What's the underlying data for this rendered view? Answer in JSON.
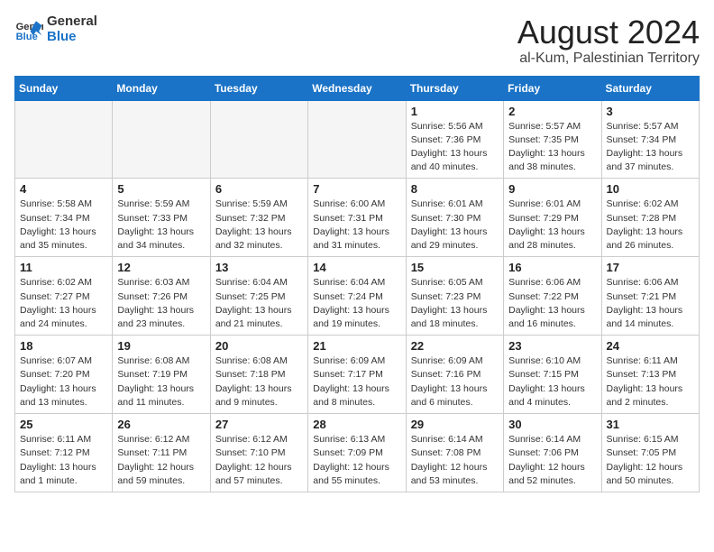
{
  "logo": {
    "text_general": "General",
    "text_blue": "Blue"
  },
  "title": "August 2024",
  "subtitle": "al-Kum, Palestinian Territory",
  "days_of_week": [
    "Sunday",
    "Monday",
    "Tuesday",
    "Wednesday",
    "Thursday",
    "Friday",
    "Saturday"
  ],
  "weeks": [
    [
      {
        "day": "",
        "info": ""
      },
      {
        "day": "",
        "info": ""
      },
      {
        "day": "",
        "info": ""
      },
      {
        "day": "",
        "info": ""
      },
      {
        "day": "1",
        "info": "Sunrise: 5:56 AM\nSunset: 7:36 PM\nDaylight: 13 hours and 40 minutes."
      },
      {
        "day": "2",
        "info": "Sunrise: 5:57 AM\nSunset: 7:35 PM\nDaylight: 13 hours and 38 minutes."
      },
      {
        "day": "3",
        "info": "Sunrise: 5:57 AM\nSunset: 7:34 PM\nDaylight: 13 hours and 37 minutes."
      }
    ],
    [
      {
        "day": "4",
        "info": "Sunrise: 5:58 AM\nSunset: 7:34 PM\nDaylight: 13 hours and 35 minutes."
      },
      {
        "day": "5",
        "info": "Sunrise: 5:59 AM\nSunset: 7:33 PM\nDaylight: 13 hours and 34 minutes."
      },
      {
        "day": "6",
        "info": "Sunrise: 5:59 AM\nSunset: 7:32 PM\nDaylight: 13 hours and 32 minutes."
      },
      {
        "day": "7",
        "info": "Sunrise: 6:00 AM\nSunset: 7:31 PM\nDaylight: 13 hours and 31 minutes."
      },
      {
        "day": "8",
        "info": "Sunrise: 6:01 AM\nSunset: 7:30 PM\nDaylight: 13 hours and 29 minutes."
      },
      {
        "day": "9",
        "info": "Sunrise: 6:01 AM\nSunset: 7:29 PM\nDaylight: 13 hours and 28 minutes."
      },
      {
        "day": "10",
        "info": "Sunrise: 6:02 AM\nSunset: 7:28 PM\nDaylight: 13 hours and 26 minutes."
      }
    ],
    [
      {
        "day": "11",
        "info": "Sunrise: 6:02 AM\nSunset: 7:27 PM\nDaylight: 13 hours and 24 minutes."
      },
      {
        "day": "12",
        "info": "Sunrise: 6:03 AM\nSunset: 7:26 PM\nDaylight: 13 hours and 23 minutes."
      },
      {
        "day": "13",
        "info": "Sunrise: 6:04 AM\nSunset: 7:25 PM\nDaylight: 13 hours and 21 minutes."
      },
      {
        "day": "14",
        "info": "Sunrise: 6:04 AM\nSunset: 7:24 PM\nDaylight: 13 hours and 19 minutes."
      },
      {
        "day": "15",
        "info": "Sunrise: 6:05 AM\nSunset: 7:23 PM\nDaylight: 13 hours and 18 minutes."
      },
      {
        "day": "16",
        "info": "Sunrise: 6:06 AM\nSunset: 7:22 PM\nDaylight: 13 hours and 16 minutes."
      },
      {
        "day": "17",
        "info": "Sunrise: 6:06 AM\nSunset: 7:21 PM\nDaylight: 13 hours and 14 minutes."
      }
    ],
    [
      {
        "day": "18",
        "info": "Sunrise: 6:07 AM\nSunset: 7:20 PM\nDaylight: 13 hours and 13 minutes."
      },
      {
        "day": "19",
        "info": "Sunrise: 6:08 AM\nSunset: 7:19 PM\nDaylight: 13 hours and 11 minutes."
      },
      {
        "day": "20",
        "info": "Sunrise: 6:08 AM\nSunset: 7:18 PM\nDaylight: 13 hours and 9 minutes."
      },
      {
        "day": "21",
        "info": "Sunrise: 6:09 AM\nSunset: 7:17 PM\nDaylight: 13 hours and 8 minutes."
      },
      {
        "day": "22",
        "info": "Sunrise: 6:09 AM\nSunset: 7:16 PM\nDaylight: 13 hours and 6 minutes."
      },
      {
        "day": "23",
        "info": "Sunrise: 6:10 AM\nSunset: 7:15 PM\nDaylight: 13 hours and 4 minutes."
      },
      {
        "day": "24",
        "info": "Sunrise: 6:11 AM\nSunset: 7:13 PM\nDaylight: 13 hours and 2 minutes."
      }
    ],
    [
      {
        "day": "25",
        "info": "Sunrise: 6:11 AM\nSunset: 7:12 PM\nDaylight: 13 hours and 1 minute."
      },
      {
        "day": "26",
        "info": "Sunrise: 6:12 AM\nSunset: 7:11 PM\nDaylight: 12 hours and 59 minutes."
      },
      {
        "day": "27",
        "info": "Sunrise: 6:12 AM\nSunset: 7:10 PM\nDaylight: 12 hours and 57 minutes."
      },
      {
        "day": "28",
        "info": "Sunrise: 6:13 AM\nSunset: 7:09 PM\nDaylight: 12 hours and 55 minutes."
      },
      {
        "day": "29",
        "info": "Sunrise: 6:14 AM\nSunset: 7:08 PM\nDaylight: 12 hours and 53 minutes."
      },
      {
        "day": "30",
        "info": "Sunrise: 6:14 AM\nSunset: 7:06 PM\nDaylight: 12 hours and 52 minutes."
      },
      {
        "day": "31",
        "info": "Sunrise: 6:15 AM\nSunset: 7:05 PM\nDaylight: 12 hours and 50 minutes."
      }
    ]
  ]
}
